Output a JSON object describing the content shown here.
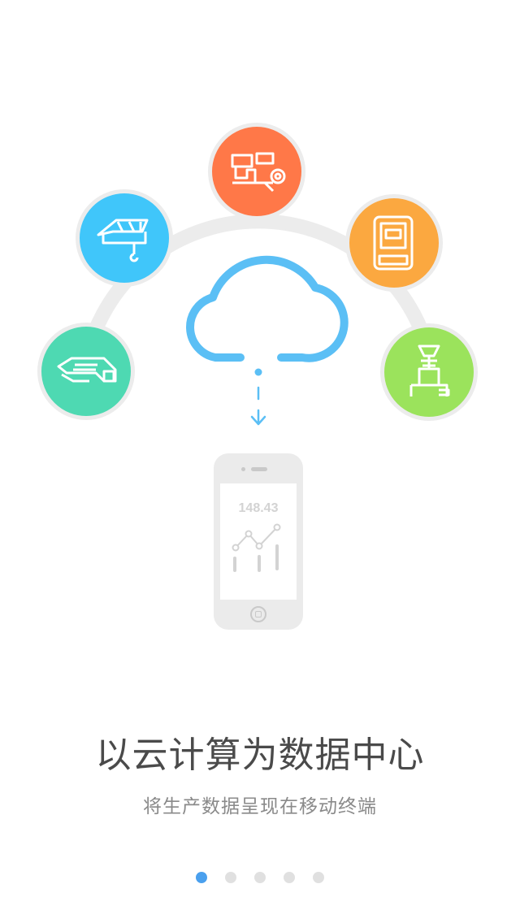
{
  "illustration": {
    "phone_reading": "148.43",
    "devices": [
      {
        "name": "machine-icon",
        "color": "#ff7848"
      },
      {
        "name": "crane-icon",
        "color": "#40c6fa"
      },
      {
        "name": "meter-icon",
        "color": "#fba840"
      },
      {
        "name": "conveyor-icon",
        "color": "#4ed9b2"
      },
      {
        "name": "valve-tower-icon",
        "color": "#9be35c"
      }
    ],
    "cloud_color": "#5bbff5"
  },
  "onboarding": {
    "title": "以云计算为数据中心",
    "subtitle": "将生产数据呈现在移动终端"
  },
  "pager": {
    "total": 5,
    "active_index": 0,
    "active_color": "#4aa0ee",
    "inactive_color": "#e0e0e0"
  }
}
